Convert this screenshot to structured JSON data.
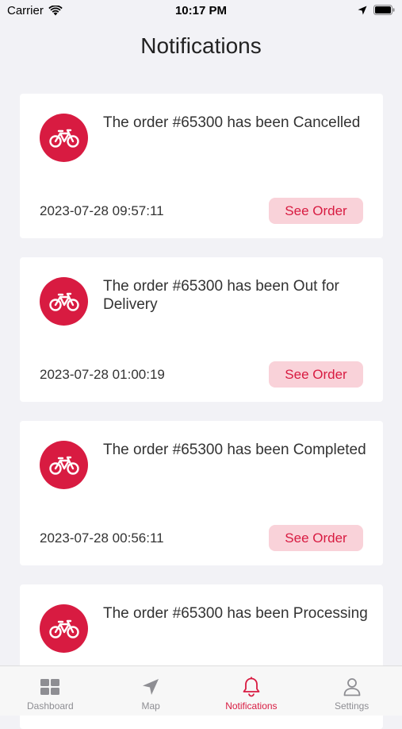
{
  "status_bar": {
    "carrier": "Carrier",
    "time": "10:17 PM"
  },
  "header": {
    "title": "Notifications"
  },
  "notifications": [
    {
      "title": "The order #65300 has been Cancelled",
      "timestamp": "2023-07-28 09:57:11",
      "action_label": "See Order"
    },
    {
      "title": "The order #65300 has been Out for Delivery",
      "timestamp": "2023-07-28 01:00:19",
      "action_label": "See Order"
    },
    {
      "title": "The order #65300 has been Completed",
      "timestamp": "2023-07-28 00:56:11",
      "action_label": "See Order"
    },
    {
      "title": "The order #65300 has been Processing",
      "timestamp": "",
      "action_label": ""
    }
  ],
  "tabbar": {
    "items": [
      {
        "label": "Dashboard",
        "icon": "grid-icon",
        "active": false
      },
      {
        "label": "Map",
        "icon": "location-arrow-icon",
        "active": false
      },
      {
        "label": "Notifications",
        "icon": "bell-icon",
        "active": true
      },
      {
        "label": "Settings",
        "icon": "person-icon",
        "active": false
      }
    ]
  },
  "colors": {
    "accent": "#d81b41",
    "accent_soft": "#f9d2d9",
    "background": "#f2f2f6"
  }
}
